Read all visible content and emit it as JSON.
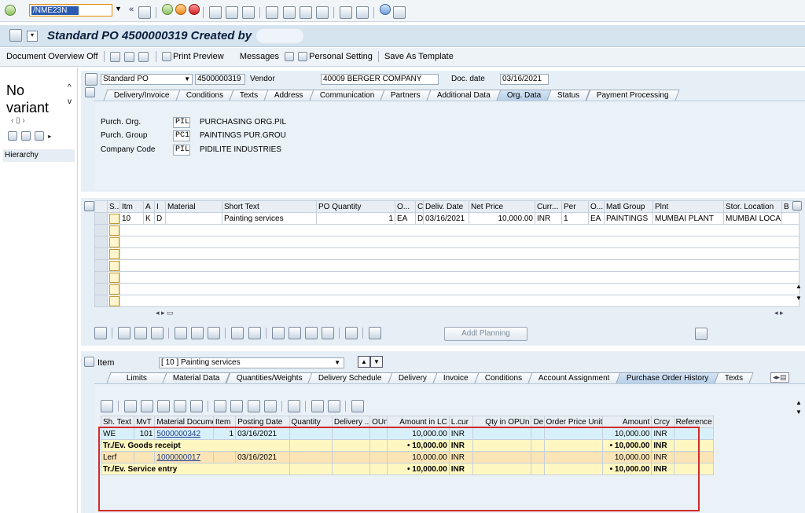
{
  "command_field": "/NME23N",
  "title": "Standard PO 4500000319 Created by",
  "app_toolbar": {
    "doc_overview": "Document Overview Off",
    "print_preview": "Print Preview",
    "messages": "Messages",
    "personal_setting": "Personal Setting",
    "save_template": "Save As Template"
  },
  "left_panel": {
    "variant_text": "No variant",
    "hierarchy": "Hierarchy"
  },
  "header": {
    "doc_type": "Standard PO",
    "po_number": "4500000319",
    "vendor_label": "Vendor",
    "vendor_value": "40009 BERGER COMPANY",
    "doc_date_label": "Doc. date",
    "doc_date_value": "03/16/2021",
    "tabs": [
      "Delivery/Invoice",
      "Conditions",
      "Texts",
      "Address",
      "Communication",
      "Partners",
      "Additional Data",
      "Org. Data",
      "Status",
      "Payment Processing"
    ],
    "active_tab": "Org. Data",
    "org_rows": [
      {
        "label": "Purch. Org.",
        "code": "PIL",
        "text": "PURCHASING ORG.PIL"
      },
      {
        "label": "Purch. Group",
        "code": "PC1",
        "text": "PAINTINGS PUR.GROU"
      },
      {
        "label": "Company Code",
        "code": "PIL",
        "text": "PIDILITE INDUSTRIES"
      }
    ]
  },
  "items_table": {
    "columns": [
      "S..",
      "Itm",
      "A",
      "I",
      "Material",
      "Short Text",
      "PO Quantity",
      "O...",
      "C",
      "Deliv. Date",
      "Net Price",
      "Curr...",
      "Per",
      "O...",
      "Matl Group",
      "Plnt",
      "Stor. Location",
      "B"
    ],
    "rows": [
      [
        "",
        "10",
        "K",
        "D",
        "",
        "Painting services",
        "1",
        "EA",
        "D",
        "03/16/2021",
        "10,000.00",
        "INR",
        "1",
        "EA",
        "PAINTINGS",
        "MUMBAI PLANT",
        "MUMBAI LOCA...",
        ""
      ]
    ]
  },
  "addl_planning": "Addl Planning",
  "item_section": {
    "item_label": "Item",
    "item_select": "[ 10 ] Painting services",
    "tabs": [
      "Limits",
      "Material Data",
      "Quantities/Weights",
      "Delivery Schedule",
      "Delivery",
      "Invoice",
      "Conditions",
      "Account Assignment",
      "Purchase Order History",
      "Texts"
    ],
    "active_tab": "Purchase Order History"
  },
  "history_table": {
    "columns": [
      "Sh. Text",
      "MvT",
      "Material Document",
      "Item",
      "Posting Date",
      "Quantity",
      "Delivery ...",
      "OUn",
      "Amount in LC",
      "L.cur",
      "Qty in OPUn",
      "De",
      "Order Price Unit",
      "Amount",
      "Crcy",
      "Reference"
    ],
    "rows": [
      {
        "kind": "detail-blue",
        "cells": [
          "WE",
          "101",
          "5000000342",
          "1",
          "03/16/2021",
          "",
          "",
          "",
          "10,000.00",
          "INR",
          "",
          "",
          "",
          "10,000.00",
          "INR",
          ""
        ]
      },
      {
        "kind": "total-yellow",
        "cells": [
          "Tr./Ev. Goods receipt",
          "",
          "",
          "",
          "",
          "",
          "",
          "",
          "• 10,000.00",
          "INR",
          "",
          "",
          "",
          "• 10,000.00",
          "INR",
          ""
        ]
      },
      {
        "kind": "detail-orange",
        "cells": [
          "Lerf",
          "",
          "1000000017",
          "",
          "03/16/2021",
          "",
          "",
          "",
          "10,000.00",
          "INR",
          "",
          "",
          "",
          "10,000.00",
          "INR",
          ""
        ]
      },
      {
        "kind": "total-yellow",
        "cells": [
          "Tr./Ev. Service entry",
          "",
          "",
          "",
          "",
          "",
          "",
          "",
          "• 10,000.00",
          "INR",
          "",
          "",
          "",
          "• 10,000.00",
          "INR",
          ""
        ]
      }
    ]
  },
  "colors": {
    "title_bar": "#d6e4f0",
    "header_bg": "#e7eff6",
    "highlight_box": "#d22b2b",
    "detail_blue": "#d8f0fa",
    "total_yellow": "#fff7c2",
    "detail_orange": "#fbe4b5"
  }
}
